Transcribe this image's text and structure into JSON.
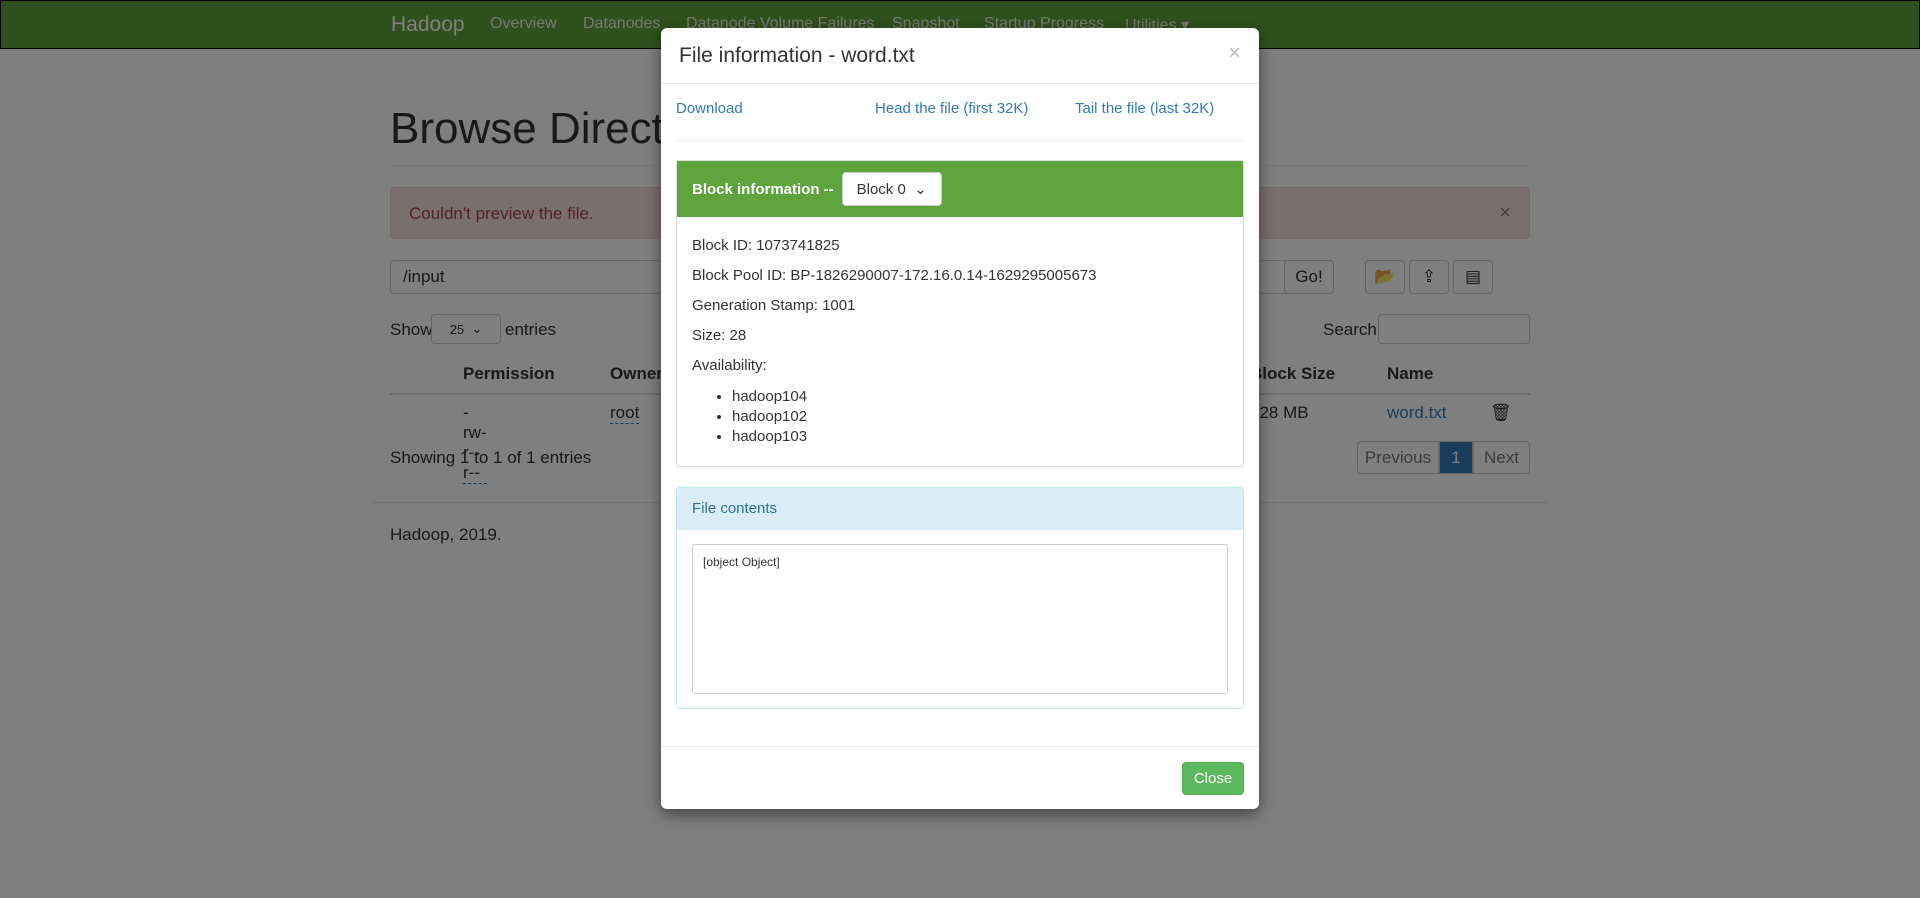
{
  "navbar": {
    "brand": "Hadoop",
    "items": [
      "Overview",
      "Datanodes",
      "Datanode Volume Failures",
      "Snapshot",
      "Startup Progress",
      "Utilities ▾"
    ]
  },
  "page": {
    "title": "Browse Directory",
    "alert": "Couldn't preview the file.",
    "alert_close": "×",
    "path": "/input",
    "go": "Go!",
    "show": "Show",
    "entries_value": "25",
    "entries": "entries",
    "search": "Search:",
    "columns": [
      "Permission",
      "Owner",
      "Block Size",
      "Name"
    ],
    "row": {
      "permission": "-rw-r--r--",
      "owner": "root",
      "block_size": "128 MB",
      "name": "word.txt"
    },
    "showing": "Showing 1 to 1 of 1 entries",
    "prev": "Previous",
    "page": "1",
    "next": "Next",
    "footer": "Hadoop, 2019."
  },
  "modal": {
    "title": "File information - word.txt",
    "close_x": "×",
    "download": "Download",
    "head": "Head the file (first 32K)",
    "tail": "Tail the file (last 32K)",
    "block_label": "Block information --",
    "block_select": "Block 0",
    "block_id": "Block ID: 1073741825",
    "pool_id": "Block Pool ID: BP-1826290007-172.16.0.14-1629295005673",
    "gen_stamp": "Generation Stamp: 1001",
    "size": "Size: 28",
    "availability": "Availability:",
    "hosts": [
      "hadoop104",
      "hadoop102",
      "hadoop103"
    ],
    "contents_label": "File contents",
    "contents": "[object Object]",
    "close": "Close"
  },
  "colors": {
    "brand": "#5ea33b",
    "close_button": "#5cb85c",
    "info_header": "#d9edf7"
  }
}
